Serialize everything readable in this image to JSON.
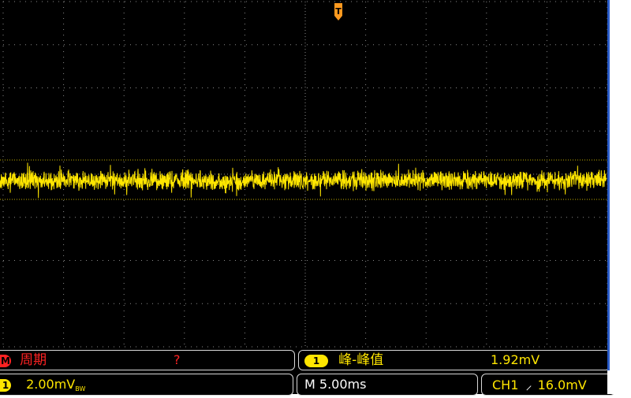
{
  "colors": {
    "trace": "#ffe600",
    "grid": "#8a8a8a",
    "background": "#000000",
    "accent_blue": "#2a5cc9",
    "measure_red": "#ff2222"
  },
  "trigger": {
    "marker_label": "T",
    "icon": "trigger-position-marker-icon"
  },
  "measurements": {
    "m1": {
      "badge": "M",
      "name": "周期",
      "value": "?"
    },
    "m2": {
      "badge": "1",
      "name": "峰-峰值",
      "value": "1.92mV"
    }
  },
  "status": {
    "ch_badge": "1",
    "volts_per_div": "2.00mV",
    "bw_suffix": "BW",
    "timebase": "M 5.00ms",
    "trigger_source": "CH1",
    "trigger_slope_icon": "rising-edge-icon",
    "trigger_slope_glyph": "⸝",
    "trigger_level": "16.0mV"
  }
}
